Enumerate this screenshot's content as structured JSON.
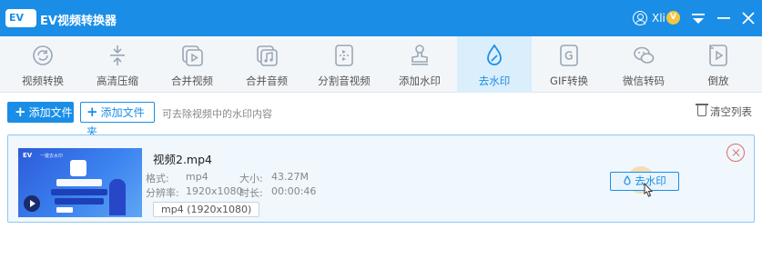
{
  "app": {
    "logo_text": "EV",
    "title": "EV视频转换器",
    "user_name": "Xli",
    "vip_badge": "V"
  },
  "toolbar": {
    "items": [
      {
        "label": "视频转换",
        "icon": "convert-icon"
      },
      {
        "label": "高清压缩",
        "icon": "compress-icon"
      },
      {
        "label": "合并视频",
        "icon": "merge-video-icon"
      },
      {
        "label": "合并音频",
        "icon": "merge-audio-icon"
      },
      {
        "label": "分割音视频",
        "icon": "split-icon"
      },
      {
        "label": "添加水印",
        "icon": "stamp-icon"
      },
      {
        "label": "去水印",
        "icon": "drop-icon",
        "active": true
      },
      {
        "label": "GIF转换",
        "icon": "gif-icon"
      },
      {
        "label": "微信转码",
        "icon": "wechat-icon"
      },
      {
        "label": "倒放",
        "icon": "reverse-icon"
      }
    ]
  },
  "actions": {
    "add_file": "添加文件",
    "add_folder": "添加文件夹",
    "hint": "可去除视频中的水印内容",
    "clear_list": "清空列表"
  },
  "file": {
    "name": "视频2.mp4",
    "format_label": "格式:",
    "format_value": "mp4",
    "size_label": "大小:",
    "size_value": "43.27M",
    "resolution_label": "分辨率:",
    "resolution_value": "1920x1080",
    "duration_label": "时长:",
    "duration_value": "00:00:46",
    "format_chip": "mp4 (1920x1080)",
    "remove_button": "去水印",
    "thumbnail": {
      "logo": "EV",
      "logo_sub": "一键去水印"
    }
  },
  "colors": {
    "accent": "#1a8ee6",
    "active_tab_bg": "#daeefc",
    "card_bg": "#f0f7fd",
    "close_red": "#e06a6a"
  }
}
